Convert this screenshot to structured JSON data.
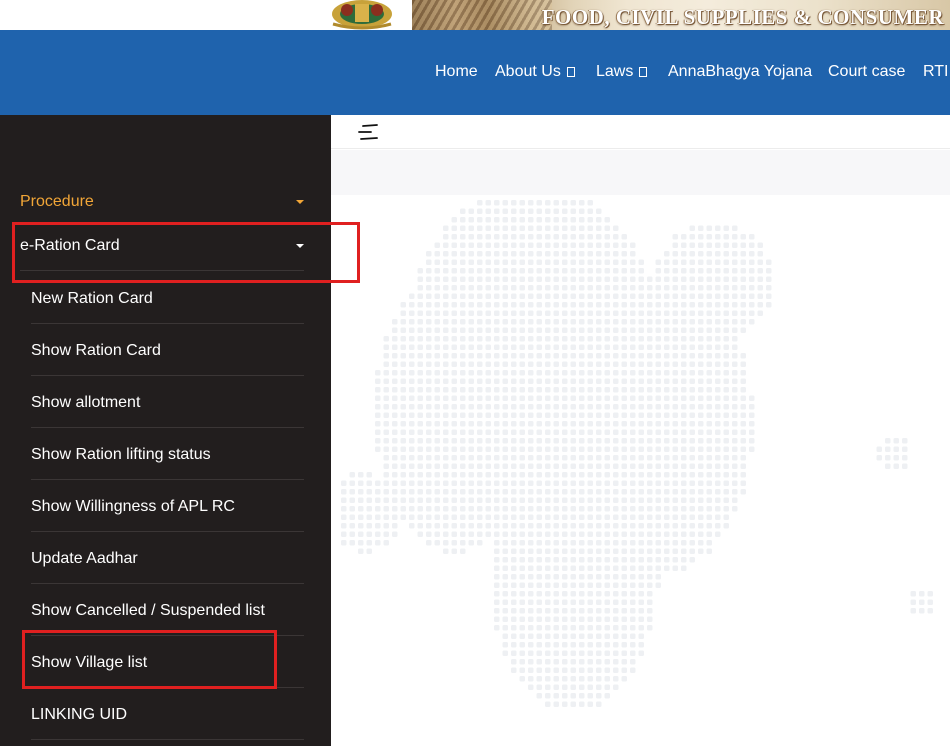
{
  "banner": {
    "title": "FOOD, CIVIL SUPPLIES & CONSUMER"
  },
  "nav": {
    "items": [
      {
        "label": "Home",
        "dropdown": false
      },
      {
        "label": "About Us",
        "dropdown": true
      },
      {
        "label": "Laws",
        "dropdown": true
      },
      {
        "label": "AnnaBhagya Yojana",
        "dropdown": false
      },
      {
        "label": "Court case",
        "dropdown": false
      },
      {
        "label": "RTI",
        "dropdown": false
      }
    ]
  },
  "sidebar": {
    "procedure": {
      "label": "Procedure",
      "icon": "caret-down-icon"
    },
    "eration": {
      "label": "e-Ration Card",
      "icon": "caret-down-icon",
      "expanded": true
    },
    "subitems": [
      {
        "label": "New Ration Card"
      },
      {
        "label": "Show Ration Card"
      },
      {
        "label": "Show allotment"
      },
      {
        "label": "Show Ration lifting status"
      },
      {
        "label": "Show Willingness of APL RC"
      },
      {
        "label": "Update Aadhar"
      },
      {
        "label": "Show Cancelled / Suspended list"
      },
      {
        "label": "Show Village list"
      },
      {
        "label": "LINKING UID"
      }
    ]
  },
  "toolbar": {
    "toggle_icon": "menu-toggle-icon"
  },
  "colors": {
    "navbar": "#1f63ad",
    "sidebar": "#221e1e",
    "accent": "#f2a637",
    "highlight": "#e02020"
  }
}
